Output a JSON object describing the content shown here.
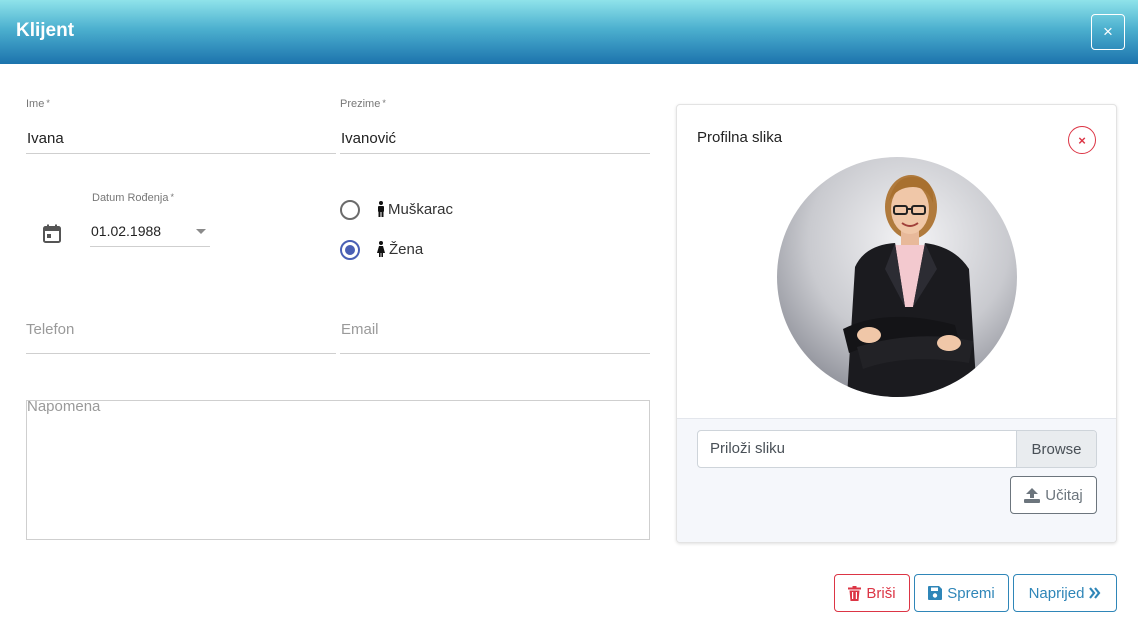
{
  "dialog": {
    "title": "Klijent",
    "close_label": "×"
  },
  "form": {
    "first_name": {
      "label": "Ime",
      "required": "*",
      "value": "Ivana"
    },
    "last_name": {
      "label": "Prezime",
      "required": "*",
      "value": "Ivanović"
    },
    "birth_date": {
      "label": "Datum Rođenja",
      "required": "*",
      "value": "01.02.1988"
    },
    "gender": {
      "options": [
        {
          "label": "Muškarac",
          "checked": false
        },
        {
          "label": "Žena",
          "checked": true
        }
      ]
    },
    "phone": {
      "placeholder": "Telefon",
      "value": ""
    },
    "email": {
      "placeholder": "Email",
      "value": ""
    },
    "note": {
      "placeholder": "Napomena",
      "value": ""
    }
  },
  "profile_card": {
    "title": "Profilna slika",
    "remove_label": "×",
    "file_placeholder": "Priloži sliku",
    "browse_label": "Browse",
    "upload_label": "Učitaj"
  },
  "footer": {
    "delete_label": "Briši",
    "save_label": "Spremi",
    "next_label": "Naprijed"
  },
  "colors": {
    "header_gradient": [
      "#8fe3ea",
      "#4cb0cf",
      "#1c73ad"
    ],
    "danger": "#dc3545",
    "primary": "#2f86b8",
    "radio_accent": "#4a5fb5"
  },
  "icons": [
    "calendar-icon",
    "male-icon",
    "female-icon",
    "trash-icon",
    "save-icon",
    "chevrons-right-icon",
    "upload-icon",
    "close-icon"
  ]
}
